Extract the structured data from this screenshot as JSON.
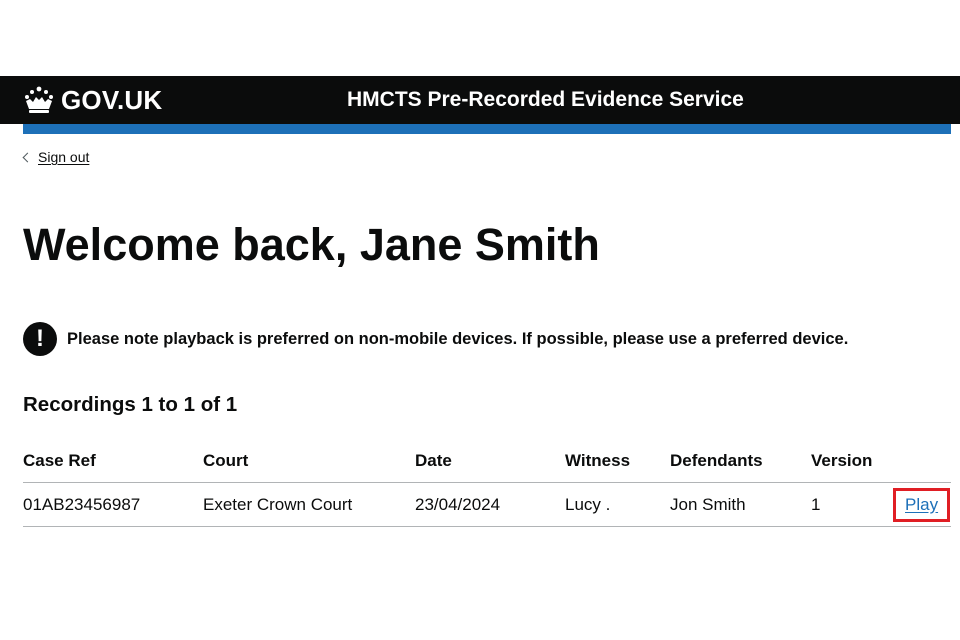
{
  "header": {
    "logo_text": "GOV.UK",
    "service_name": "HMCTS Pre-Recorded Evidence Service",
    "bar_color": "#1d70b8"
  },
  "back_link": {
    "label": "Sign out"
  },
  "page": {
    "title": "Welcome back, Jane Smith"
  },
  "warning": {
    "icon": "!",
    "text": "Please note playback is preferred on non-mobile devices. If possible, please use a preferred device."
  },
  "recordings": {
    "caption": "Recordings 1 to 1 of 1",
    "columns": [
      "Case Ref",
      "Court",
      "Date",
      "Witness",
      "Defendants",
      "Version"
    ],
    "rows": [
      {
        "case_ref": "01AB23456987",
        "court": "Exeter Crown Court",
        "date": "23/04/2024",
        "witness": "Lucy .",
        "defendants": "Jon Smith",
        "version": "1",
        "action": "Play"
      }
    ]
  },
  "colors": {
    "link": "#1d70b8",
    "highlight": "#e01e24",
    "header_bg": "#0b0c0c"
  }
}
